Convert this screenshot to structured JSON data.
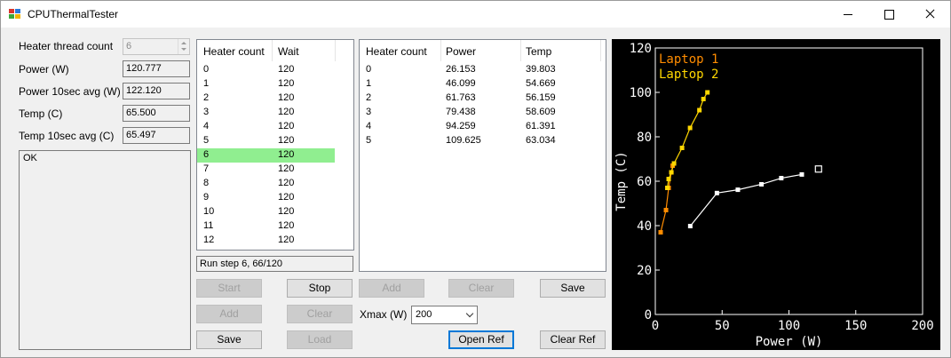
{
  "window": {
    "title": "CPUThermalTester"
  },
  "left_panel": {
    "heater_thread_count": {
      "label": "Heater thread count",
      "value": "6"
    },
    "power": {
      "label": "Power (W)",
      "value": "120.777"
    },
    "power_avg": {
      "label": "Power 10sec avg (W)",
      "value": "122.120"
    },
    "temp": {
      "label": "Temp (C)",
      "value": "65.500"
    },
    "temp_avg": {
      "label": "Temp 10sec avg  (C)",
      "value": "65.497"
    },
    "status_text": "OK"
  },
  "schedule": {
    "headers": [
      "Heater count",
      "Wait"
    ],
    "rows": [
      [
        "0",
        "120"
      ],
      [
        "1",
        "120"
      ],
      [
        "2",
        "120"
      ],
      [
        "3",
        "120"
      ],
      [
        "4",
        "120"
      ],
      [
        "5",
        "120"
      ],
      [
        "6",
        "120"
      ],
      [
        "7",
        "120"
      ],
      [
        "8",
        "120"
      ],
      [
        "9",
        "120"
      ],
      [
        "10",
        "120"
      ],
      [
        "11",
        "120"
      ],
      [
        "12",
        "120"
      ]
    ],
    "selected_index": 6,
    "run_status": "Run step 6, 66/120",
    "buttons": {
      "start": "Start",
      "stop": "Stop",
      "add": "Add",
      "clear": "Clear",
      "save": "Save",
      "load": "Load"
    }
  },
  "results": {
    "headers": [
      "Heater count",
      "Power",
      "Temp"
    ],
    "rows": [
      [
        "0",
        "26.153",
        "39.803"
      ],
      [
        "1",
        "46.099",
        "54.669"
      ],
      [
        "2",
        "61.763",
        "56.159"
      ],
      [
        "3",
        "79.438",
        "58.609"
      ],
      [
        "4",
        "94.259",
        "61.391"
      ],
      [
        "5",
        "109.625",
        "63.034"
      ]
    ],
    "buttons": {
      "add": "Add",
      "clear": "Clear",
      "save": "Save",
      "open_ref": "Open Ref",
      "clear_ref": "Clear Ref"
    },
    "xmax_label": "Xmax (W)",
    "xmax_value": "200"
  },
  "chart_data": {
    "type": "line",
    "xlabel": "Power (W)",
    "ylabel": "Temp (C)",
    "xlim": [
      0,
      200
    ],
    "ylim": [
      0,
      120
    ],
    "xticks": [
      0,
      50,
      100,
      150,
      200
    ],
    "yticks": [
      0,
      20,
      40,
      60,
      80,
      100,
      120
    ],
    "background": "#000000",
    "legend_placement": "top-left",
    "series": [
      {
        "name": "Laptop 1",
        "color": "#ff8c00",
        "x": [
          4,
          8,
          10,
          12,
          13
        ],
        "y": [
          37,
          47,
          57,
          64,
          67
        ]
      },
      {
        "name": "Laptop 2",
        "color": "#ffd700",
        "x": [
          9,
          10,
          12,
          14,
          20,
          26,
          33,
          36,
          39
        ],
        "y": [
          57,
          61,
          64,
          68,
          75,
          84,
          92,
          97,
          100
        ]
      },
      {
        "name": "",
        "color": "#ffffff",
        "x": [
          26.153,
          46.099,
          61.763,
          79.438,
          94.259,
          109.625
        ],
        "y": [
          39.803,
          54.669,
          56.159,
          58.609,
          61.391,
          63.034
        ]
      }
    ],
    "current_point": {
      "x": 122.12,
      "y": 65.497,
      "color": "#ffffff"
    }
  }
}
